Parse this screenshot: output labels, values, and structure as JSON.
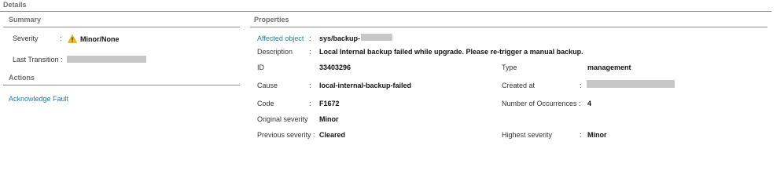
{
  "section_title": "Details",
  "summary": {
    "title": "Summary",
    "severity_label": "Severity",
    "severity_value": "Minor/None",
    "last_transition_label": "Last Transition :"
  },
  "actions": {
    "title": "Actions",
    "acknowledge_label": "Acknowledge Fault"
  },
  "properties": {
    "title": "Properties",
    "affected_object_label": "Affected object",
    "affected_object_value": "sys/backup-",
    "description_label": "Description",
    "description_value": "Local Internal backup failed while upgrade. Please re-trigger a manual backup.",
    "id_label": "ID",
    "id_value": "33403296",
    "type_label": "Type",
    "type_value": "management",
    "cause_label": "Cause",
    "cause_value": "local-internal-backup-failed",
    "created_label": "Created at",
    "code_label": "Code",
    "code_value": "F1672",
    "occurrences_label": "Number of Occurrences :",
    "occurrences_value": "4",
    "original_severity_label": "Original severity",
    "original_severity_value": "Minor",
    "previous_severity_label": "Previous severity :",
    "previous_severity_value": "Cleared",
    "highest_severity_label": "Highest severity",
    "highest_severity_value": "Minor"
  },
  "colon": ":",
  "colors": {
    "link": "#1f7fa8",
    "warning": "#f2c200",
    "divider": "#8c8c8c"
  },
  "icons": {
    "severity": "warning-triangle-icon"
  }
}
